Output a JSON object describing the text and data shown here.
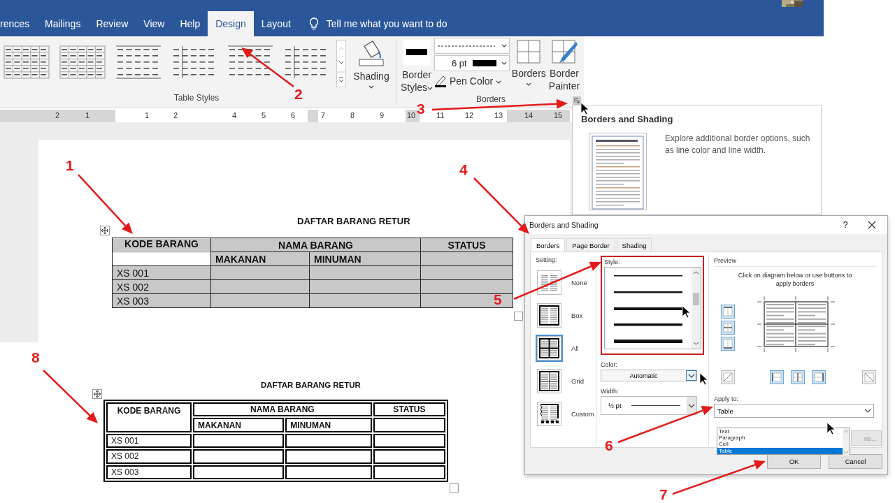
{
  "ribbon": {
    "tabs": [
      {
        "label": "rences",
        "selected": false
      },
      {
        "label": "Mailings",
        "selected": false
      },
      {
        "label": "Review",
        "selected": false
      },
      {
        "label": "View",
        "selected": false
      },
      {
        "label": "Help",
        "selected": false
      },
      {
        "label": "Design",
        "selected": true
      },
      {
        "label": "Layout",
        "selected": false
      }
    ],
    "tell_me": "Tell me what you want to do",
    "table_styles_group": "Table Styles",
    "shading": "Shading",
    "border_styles": "Border Styles",
    "pen_weight": "6 pt",
    "pen_color": "Pen Color",
    "borders": "Borders",
    "border_painter": "Border Painter",
    "borders_group": "Borders"
  },
  "ruler": {
    "labels": [
      "2",
      "1",
      "1",
      "2",
      "4",
      "5",
      "6",
      "7",
      "8",
      "9",
      "10",
      "11",
      "12",
      "13",
      "14",
      "15"
    ]
  },
  "tooltip": {
    "title": "Borders and Shading",
    "text": "Explore additional border options, such as line color and line width."
  },
  "tables": [
    {
      "kind": "shaded",
      "title": "DAFTAR BARANG RETUR",
      "header": [
        "KODE BARANG",
        "NAMA BARANG",
        "STATUS"
      ],
      "subheader": [
        "MAKANAN",
        "MINUMAN"
      ],
      "rows": [
        "XS 001",
        "XS 002",
        "XS 003"
      ]
    },
    {
      "kind": "double",
      "title": "DAFTAR BARANG RETUR",
      "header": [
        "KODE BARANG",
        "NAMA BARANG",
        "STATUS"
      ],
      "subheader": [
        "MAKANAN",
        "MINUMAN"
      ],
      "rows": [
        "XS 001",
        "XS 002",
        "XS 003"
      ]
    }
  ],
  "dialog": {
    "title": "Borders and Shading",
    "help": "?",
    "tabs": [
      {
        "label": "Borders",
        "selected": true
      },
      {
        "label": "Page Border",
        "selected": false
      },
      {
        "label": "Shading",
        "selected": false
      }
    ],
    "setting_label": "Setting:",
    "settings": [
      {
        "kind": "none",
        "label": "None",
        "selected": false
      },
      {
        "kind": "box",
        "label": "Box",
        "selected": false
      },
      {
        "kind": "all",
        "label": "All",
        "selected": true
      },
      {
        "kind": "grid",
        "label": "Grid",
        "selected": false
      },
      {
        "kind": "custom",
        "label": "Custom",
        "selected": false
      }
    ],
    "style_label": "Style:",
    "color_label": "Color:",
    "color_value": "Automatic",
    "width_label": "Width:",
    "width_value": "½ pt",
    "preview_label": "Preview",
    "preview_hint": "Click on diagram below or use buttons to apply borders",
    "apply_label": "Apply to:",
    "apply_value": "Table",
    "apply_options": [
      {
        "label": "Text",
        "selected": false
      },
      {
        "label": "Paragraph",
        "selected": false
      },
      {
        "label": "Cell",
        "selected": false
      },
      {
        "label": "Table",
        "selected": true
      }
    ],
    "options_button": "ns...",
    "ok": "OK",
    "cancel": "Cancel"
  },
  "annotations": [
    {
      "label": "1"
    },
    {
      "label": "2"
    },
    {
      "label": "3"
    },
    {
      "label": "4"
    },
    {
      "label": "5"
    },
    {
      "label": "6"
    },
    {
      "label": "7"
    },
    {
      "label": "8"
    }
  ]
}
